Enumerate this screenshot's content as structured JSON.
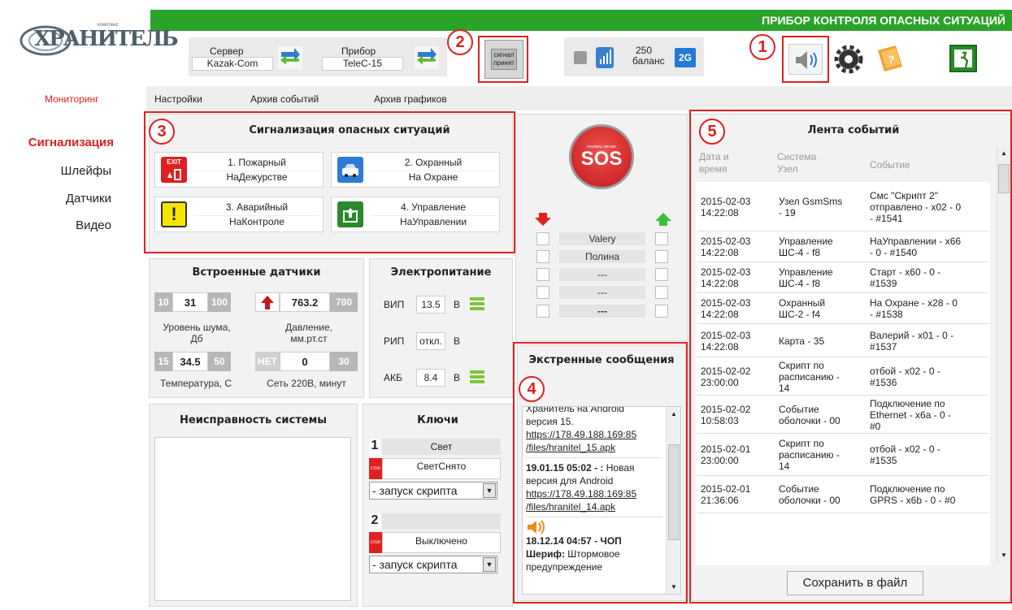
{
  "header": {
    "title": "ПРИБОР КОНТРОЛЯ ОПАСНЫХ СИТУАЦИЙ",
    "logo_text": "ХРАНИТЕЛЬ",
    "logo_small": "комплекс",
    "server_label": "Сервер",
    "server_value": "Kazak-Com",
    "device_label": "Прибор",
    "device_value": "TeleC-15",
    "signal_button": "сигнал\nпринят",
    "balance_value": "250",
    "balance_label": "баланс",
    "network": "2G"
  },
  "callouts": [
    "1",
    "2",
    "3",
    "4",
    "5"
  ],
  "tabs": [
    "Мониторинг",
    "Настройки",
    "Архив событий",
    "Архив графиков"
  ],
  "sidebar": [
    "Сигнализация",
    "Шлейфы",
    "Датчики",
    "Видео"
  ],
  "alarms": {
    "title": "Сигнализация опасных ситуаций",
    "items": [
      {
        "name": "1. Пожарный",
        "state": "НаДежурстве"
      },
      {
        "name": "2. Охранный",
        "state": "На Охране"
      },
      {
        "name": "3. Аварийный",
        "state": "НаКонтроле"
      },
      {
        "name": "4. Управление",
        "state": "НаУправлении"
      }
    ],
    "exit_text": "EXIT"
  },
  "sensors": {
    "title": "Встроенные датчики",
    "noise": {
      "min": "10",
      "value": "31",
      "max": "100",
      "label": "Уровень шума,\nДб"
    },
    "pressure": {
      "value": "763.2",
      "max": "780",
      "label": "Давление,\nмм.рт.ст"
    },
    "temp": {
      "min": "15",
      "value": "34.5",
      "max": "50",
      "label": "Температура, С"
    },
    "net": {
      "min": "НЕТ",
      "value": "0",
      "max": "30",
      "label": "Сеть 220В, минут"
    }
  },
  "power": {
    "title": "Электропитание",
    "rows": [
      {
        "label": "ВИП",
        "value": "13.5",
        "unit": "В"
      },
      {
        "label": "РИП",
        "value": "откл.",
        "unit": "В"
      },
      {
        "label": "АКБ",
        "value": "8.4",
        "unit": "В"
      }
    ]
  },
  "sos": {
    "label": "SOS",
    "small": "послать сигнал"
  },
  "users": [
    "Valery",
    "Полина",
    "---",
    "---",
    "---"
  ],
  "faults": {
    "title": "Неисправность системы"
  },
  "keys": {
    "title": "Ключи",
    "items": [
      {
        "num": "1",
        "name": "Свет",
        "state": "СветСнято",
        "script": "- запуск скрипта"
      },
      {
        "num": "2",
        "name": "",
        "state": "Выключено",
        "script": "- запуск скрипта"
      }
    ],
    "stop": "стоп"
  },
  "messages": {
    "title": "Экстренные сообщения",
    "m0_tail": "Хранитель на Android",
    "m0_text": "версия 15.",
    "m0_link1": "https://178.49.188.169:85",
    "m0_link2": "/files/hranitel_15.apk",
    "m1_head": "19.01.15 05:02 - :",
    "m1_text1": " Новая",
    "m1_text2": "версия для Android",
    "m1_link1": "https://178.49.188.169:85",
    "m1_link2": "/files/hranitel_14.apk",
    "m2_head": "18.12.14 04:57 - ЧОП",
    "m2_bold": "Шериф:",
    "m2_text1": " Штормовое",
    "m2_text2": "предупреждение"
  },
  "events": {
    "title": "Лента событий",
    "col_date": "Дата и\nвремя",
    "col_sys": "Система\nУзел",
    "col_ev": "Событие",
    "rows": [
      {
        "d": "2015-02-03\n14:22:08",
        "s": "Узел GsmSms\n- 19",
        "e": "Смс \"Скрипт 2\"\nотправлено - x02 - 0\n- #1541"
      },
      {
        "d": "2015-02-03\n14:22:08",
        "s": "Управление\nШС-4 - f8",
        "e": "НаУправлении - x66\n- 0 - #1540"
      },
      {
        "d": "2015-02-03\n14:22:08",
        "s": "Управление\nШС-4 - f8",
        "e": "Старт - x60 - 0 -\n#1539"
      },
      {
        "d": "2015-02-03\n14:22:08",
        "s": "Охранный\nШС-2 - f4",
        "e": "На Охране - x28 - 0\n- #1538"
      },
      {
        "d": "2015-02-03\n14:22:08",
        "s": "Карта - 35",
        "e": "Валерий - x01 - 0 -\n#1537"
      },
      {
        "d": "2015-02-02\n23:00:00",
        "s": "Скрипт по\nрасписанию -\n14",
        "e": "отбой - x02 - 0 -\n#1536"
      },
      {
        "d": "2015-02-02\n10:58:03",
        "s": "Событие\nоболочки - 00",
        "e": "Подключение по\nEthernet - x6a - 0 -\n#0"
      },
      {
        "d": "2015-02-01\n23:00:00",
        "s": "Скрипт по\nрасписанию -\n14",
        "e": "отбой - x02 - 0 -\n#1535"
      },
      {
        "d": "2015-02-01\n21:36:06",
        "s": "Событие\nоболочки - 00",
        "e": "Подключение по\nGPRS - x6b - 0 - #0"
      }
    ],
    "save_button": "Сохранить в файл"
  },
  "colors": {
    "header_green": "#29a329",
    "red": "#e02020",
    "accent_red": "#e02020"
  }
}
